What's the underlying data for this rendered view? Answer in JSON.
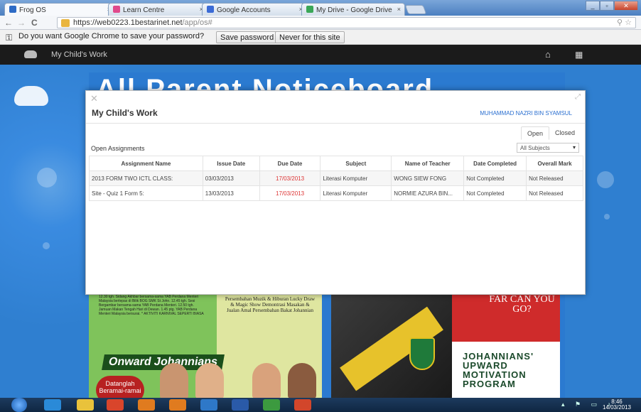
{
  "browser": {
    "tabs": [
      {
        "label": "Frog OS",
        "color": "#2d6bc6"
      },
      {
        "label": "Learn Centre",
        "color": "#e04a8c"
      },
      {
        "label": "Google Accounts",
        "color": "#3b6bd6"
      },
      {
        "label": "My Drive - Google Drive",
        "color": "#3aa757"
      }
    ],
    "tab_close": "×",
    "url_host": "https://web0223.1bestarinet.net",
    "url_path": "/app/os#",
    "back": "←",
    "forward": "→",
    "reload": "C",
    "omni_icons": "⚲ ☆",
    "win_min": "_",
    "win_max": "▫",
    "win_close": "✕"
  },
  "password_bar": {
    "message": "Do you want Google Chrome to save your password?",
    "save_label": "Save password",
    "never_label": "Never for this site",
    "key_icon": "⚿"
  },
  "frog_nav": {
    "title": "My Child's Work",
    "home_icon": "⌂",
    "apps_icon": "▦"
  },
  "notice_board": {
    "title": "All Parent Noticeboard"
  },
  "posters": {
    "left": {
      "banner": "Onward Johannians",
      "circle_text": "Datanglah Beramai-ramai",
      "schedule": "12.30 tgh.  Sidang Akhbar bersama-sama YAB Perdana Menteri Malaysia berlepas di Bilik BOG SMK St John. 12.45 tgh. Sesi Bergambar bersama-sama YAB Perdana Menteri. 12.50 tgh. Jamuan Makan Tengah Hari di Dewan. 1.45 ptg. YAB Perdana Menteri Malaysia bersurai. * AKTIVITI KARNIVAL SEPERTI BIASA",
      "centre": "Persembahan Muzik & Hiburan Lucky Draw & Magic Show Demontrasi Masakan & Jualan Amal Persembahan Bakat Johannian"
    },
    "right": {
      "can_you": "FAR CAN YOU GO?",
      "acronym": "JOHANNIANS' UPWARD MOTIVATION PROGRAM"
    }
  },
  "modal": {
    "close_icon": "✕",
    "resize_icon": "⤢",
    "title": "My Child's Work",
    "user": "MUHAMMAD NAZRI BIN SYAMSUL",
    "tabs": {
      "open": "Open",
      "closed": "Closed"
    },
    "open_label": "Open Assignments",
    "subject_filter": "All Subjects",
    "subject_arrow": "▾",
    "columns": [
      "Assignment Name",
      "Issue Date",
      "Due Date",
      "Subject",
      "Name of Teacher",
      "Date Completed",
      "Overall Mark"
    ],
    "rows": [
      {
        "name": "2013 FORM TWO ICTL CLASS:",
        "issue": "03/03/2013",
        "due": "17/03/2013",
        "subject": "Literasi Komputer",
        "teacher": "WONG SIEW FONG",
        "completed": "Not Completed",
        "mark": "Not Released"
      },
      {
        "name": "Site - Quiz 1 Form 5:",
        "issue": "13/03/2013",
        "due": "17/03/2013",
        "subject": "Literasi Komputer",
        "teacher": "NORMIE AZURA BIN...",
        "completed": "Not Completed",
        "mark": "Not Released"
      }
    ]
  },
  "taskbar": {
    "clock_time": "8:46",
    "clock_date": "14/03/2013",
    "tray_icons": "▴ ⚑ ▭ ♪",
    "colors": [
      "#2a8ad8",
      "#e9c23b",
      "#d9452b",
      "#e07b1f",
      "#2e78c8",
      "#2a5aa8",
      "#3c9a3f",
      "#d2462b"
    ]
  }
}
